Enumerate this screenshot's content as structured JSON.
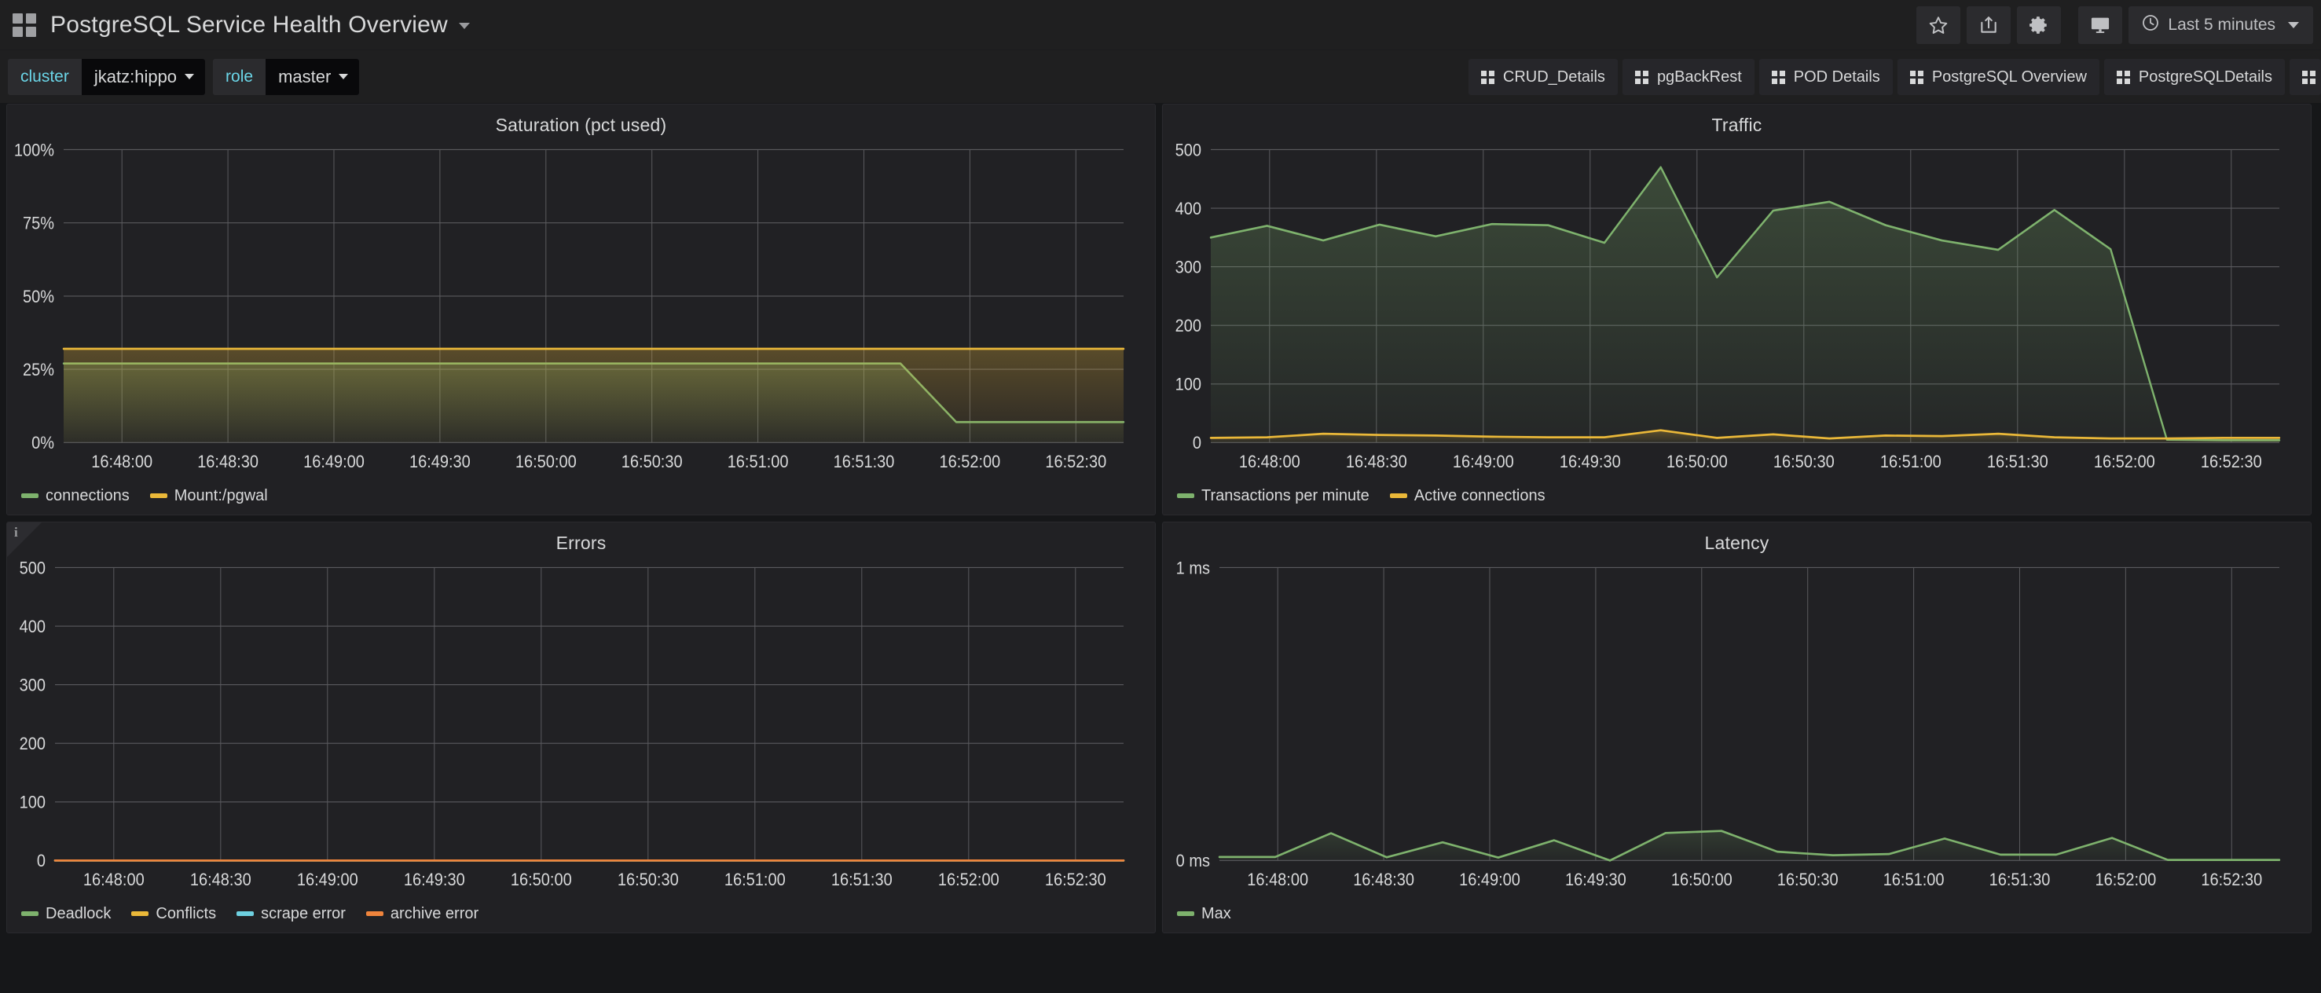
{
  "navbar": {
    "logo_icon": "grid-logo-icon",
    "title": "PostgreSQL Service Health Overview",
    "title_caret_icon": "chevron-down-icon",
    "buttons": [
      {
        "name": "star-icon",
        "label": "Mark as favorite"
      },
      {
        "name": "share-icon",
        "label": "Share dashboard"
      },
      {
        "name": "gear-icon",
        "label": "Dashboard settings"
      }
    ],
    "kiosk_button": {
      "name": "tv-icon",
      "label": "Cycle view mode"
    },
    "time_picker": {
      "clock_icon": "clock-icon",
      "range": "Last 5 minutes",
      "caret_icon": "chevron-down-icon"
    }
  },
  "submenu": {
    "variables": [
      {
        "label": "cluster",
        "value": "jkatz:hippo",
        "caret_icon": "chevron-down-icon"
      },
      {
        "label": "role",
        "value": "master",
        "caret_icon": "chevron-down-icon"
      }
    ],
    "dashboard_links": [
      {
        "label": "CRUD_Details",
        "icon": "dashboard-grid-icon"
      },
      {
        "label": "pgBackRest",
        "icon": "dashboard-grid-icon"
      },
      {
        "label": "POD Details",
        "icon": "dashboard-grid-icon"
      },
      {
        "label": "PostgreSQL Overview",
        "icon": "dashboard-grid-icon"
      },
      {
        "label": "PostgreSQLDetails",
        "icon": "dashboard-grid-icon"
      },
      {
        "label": "",
        "icon": "dashboard-grid-icon"
      }
    ]
  },
  "colors": {
    "green": "#7eb26d",
    "yellow": "#eab839",
    "blue": "#6ed0e0",
    "orange": "#ef843c",
    "panel_bg": "#212124",
    "page_bg": "#161719",
    "grid": "#5a5a5e",
    "accent": "#6bd6e8"
  },
  "panels": [
    {
      "title": "Saturation (pct used)",
      "has_info_corner": false
    },
    {
      "title": "Traffic",
      "has_info_corner": false
    },
    {
      "title": "Errors",
      "has_info_corner": true,
      "info_glyph": "i"
    },
    {
      "title": "Latency",
      "has_info_corner": false
    }
  ],
  "chart_data": [
    {
      "type": "area",
      "title": "Saturation (pct used)",
      "xlabel": "",
      "ylabel": "",
      "ylim": [
        0,
        100
      ],
      "yticks": [
        0,
        25,
        50,
        75,
        100
      ],
      "ytick_labels": [
        "0%",
        "25%",
        "50%",
        "75%",
        "100%"
      ],
      "grid": true,
      "legend_position": "bottom-left",
      "x": [
        "16:47:45",
        "16:48:00",
        "16:48:15",
        "16:48:30",
        "16:48:45",
        "16:49:00",
        "16:49:15",
        "16:49:30",
        "16:49:45",
        "16:50:00",
        "16:50:15",
        "16:50:30",
        "16:50:45",
        "16:51:00",
        "16:51:15",
        "16:51:30",
        "16:51:45",
        "16:52:00",
        "16:52:15",
        "16:52:30"
      ],
      "xtick_labels": [
        "16:48:00",
        "16:48:30",
        "16:49:00",
        "16:49:30",
        "16:50:00",
        "16:50:30",
        "16:51:00",
        "16:51:30",
        "16:52:00",
        "16:52:30"
      ],
      "series": [
        {
          "name": "connections",
          "color": "#7eb26d",
          "values": [
            27,
            27,
            27,
            27,
            27,
            27,
            27,
            27,
            27,
            27,
            27,
            27,
            27,
            27,
            27,
            27,
            7,
            7,
            7,
            7
          ]
        },
        {
          "name": "Mount:/pgwal",
          "color": "#eab839",
          "values": [
            32,
            32,
            32,
            32,
            32,
            32,
            32,
            32,
            32,
            32,
            32,
            32,
            32,
            32,
            32,
            32,
            32,
            32,
            32,
            32
          ]
        }
      ]
    },
    {
      "type": "area",
      "title": "Traffic",
      "xlabel": "",
      "ylabel": "",
      "ylim": [
        0,
        500
      ],
      "yticks": [
        0,
        100,
        200,
        300,
        400,
        500
      ],
      "ytick_labels": [
        "0",
        "100",
        "200",
        "300",
        "400",
        "500"
      ],
      "grid": true,
      "legend_position": "bottom-left",
      "x": [
        "16:47:45",
        "16:48:00",
        "16:48:15",
        "16:48:30",
        "16:48:45",
        "16:49:00",
        "16:49:15",
        "16:49:30",
        "16:49:45",
        "16:50:00",
        "16:50:15",
        "16:50:30",
        "16:50:45",
        "16:51:00",
        "16:51:15",
        "16:51:30",
        "16:51:45",
        "16:52:00",
        "16:52:15",
        "16:52:30"
      ],
      "xtick_labels": [
        "16:48:00",
        "16:48:30",
        "16:49:00",
        "16:49:30",
        "16:50:00",
        "16:50:30",
        "16:51:00",
        "16:51:30",
        "16:52:00",
        "16:52:30"
      ],
      "series": [
        {
          "name": "Transactions per minute",
          "color": "#7eb26d",
          "values": [
            350,
            370,
            345,
            372,
            352,
            373,
            371,
            341,
            470,
            282,
            396,
            411,
            371,
            345,
            329,
            397,
            330,
            5,
            4,
            4
          ]
        },
        {
          "name": "Active connections",
          "color": "#eab839",
          "values": [
            8,
            9,
            15,
            13,
            12,
            10,
            9,
            9,
            21,
            8,
            14,
            7,
            12,
            11,
            15,
            9,
            7,
            7,
            8,
            8
          ]
        }
      ]
    },
    {
      "type": "line",
      "title": "Errors",
      "xlabel": "",
      "ylabel": "",
      "ylim": [
        0,
        500
      ],
      "yticks": [
        0,
        100,
        200,
        300,
        400,
        500
      ],
      "ytick_labels": [
        "0",
        "100",
        "200",
        "300",
        "400",
        "500"
      ],
      "grid": true,
      "legend_position": "bottom-left",
      "x": [
        "16:47:45",
        "16:48:00",
        "16:48:15",
        "16:48:30",
        "16:48:45",
        "16:49:00",
        "16:49:15",
        "16:49:30",
        "16:49:45",
        "16:50:00",
        "16:50:15",
        "16:50:30",
        "16:50:45",
        "16:51:00",
        "16:51:15",
        "16:51:30",
        "16:51:45",
        "16:52:00",
        "16:52:15",
        "16:52:30"
      ],
      "xtick_labels": [
        "16:48:00",
        "16:48:30",
        "16:49:00",
        "16:49:30",
        "16:50:00",
        "16:50:30",
        "16:51:00",
        "16:51:30",
        "16:52:00",
        "16:52:30"
      ],
      "series": [
        {
          "name": "Deadlock",
          "color": "#7eb26d",
          "values": [
            0,
            0,
            0,
            0,
            0,
            0,
            0,
            0,
            0,
            0,
            0,
            0,
            0,
            0,
            0,
            0,
            0,
            0,
            0,
            0
          ]
        },
        {
          "name": "Conflicts",
          "color": "#eab839",
          "values": [
            0,
            0,
            0,
            0,
            0,
            0,
            0,
            0,
            0,
            0,
            0,
            0,
            0,
            0,
            0,
            0,
            0,
            0,
            0,
            0
          ]
        },
        {
          "name": "scrape error",
          "color": "#6ed0e0",
          "values": [
            0,
            0,
            0,
            0,
            0,
            0,
            0,
            0,
            0,
            0,
            0,
            0,
            0,
            0,
            0,
            0,
            0,
            0,
            0,
            0
          ]
        },
        {
          "name": "archive error",
          "color": "#ef843c",
          "values": [
            0,
            0,
            0,
            0,
            0,
            0,
            0,
            0,
            0,
            0,
            0,
            0,
            0,
            0,
            0,
            0,
            0,
            0,
            0,
            0
          ]
        }
      ]
    },
    {
      "type": "line",
      "title": "Latency",
      "xlabel": "",
      "ylabel": "",
      "ylim": [
        0,
        1
      ],
      "yticks": [
        0,
        1
      ],
      "ytick_labels": [
        "0 ms",
        "1 ms"
      ],
      "grid": true,
      "legend_position": "bottom-left",
      "x": [
        "16:47:45",
        "16:48:00",
        "16:48:15",
        "16:48:30",
        "16:48:45",
        "16:49:00",
        "16:49:15",
        "16:49:30",
        "16:49:45",
        "16:50:00",
        "16:50:15",
        "16:50:30",
        "16:50:45",
        "16:51:00",
        "16:51:15",
        "16:51:30",
        "16:51:45",
        "16:52:00",
        "16:52:15",
        "16:52:30"
      ],
      "xtick_labels": [
        "16:48:00",
        "16:48:30",
        "16:49:00",
        "16:49:30",
        "16:50:00",
        "16:50:30",
        "16:51:00",
        "16:51:30",
        "16:52:00",
        "16:52:30"
      ],
      "series": [
        {
          "name": "Max",
          "color": "#7eb26d",
          "values": [
            0.012,
            0.012,
            0.093,
            0.011,
            0.062,
            0.01,
            0.069,
            0.0,
            0.094,
            0.101,
            0.03,
            0.018,
            0.022,
            0.075,
            0.02,
            0.02,
            0.077,
            0.002,
            0.002,
            0.002
          ]
        }
      ]
    }
  ]
}
